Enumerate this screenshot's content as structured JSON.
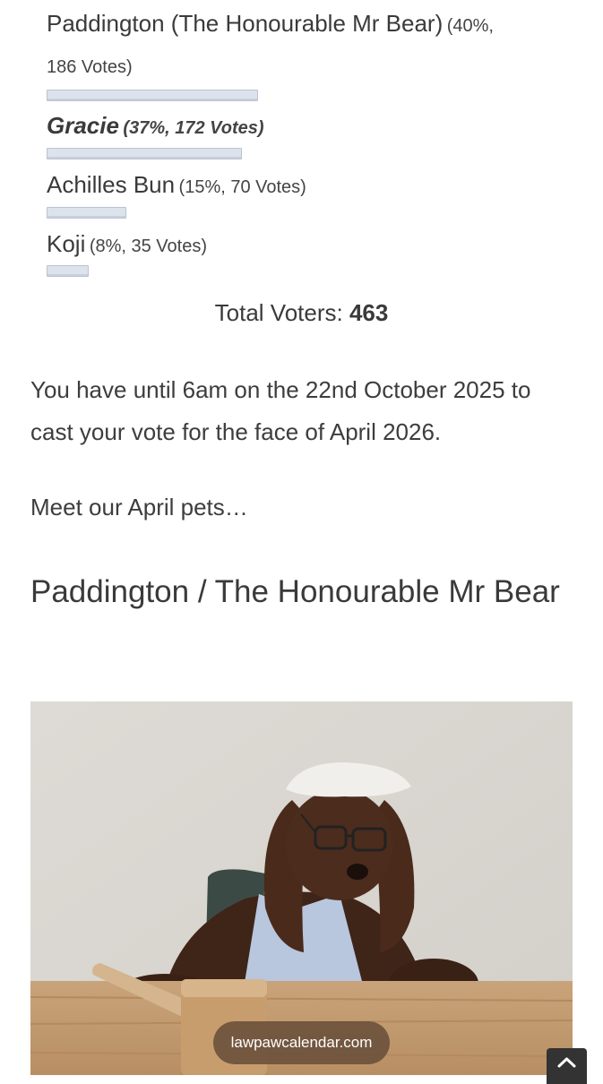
{
  "poll": {
    "options": [
      {
        "name_line1": "Paddington (The Honourable Mr Bear)",
        "meta_line1": "(40%,",
        "meta_line2": "186 Votes)",
        "percent": 40
      },
      {
        "name": "Gracie",
        "meta": "(37%, 172 Votes)",
        "percent": 37
      },
      {
        "name": "Achilles Bun",
        "meta": "(15%, 70 Votes)",
        "percent": 15
      },
      {
        "name": "Koji",
        "meta": "(8%, 35 Votes)",
        "percent": 8
      }
    ],
    "total_label": "Total Voters:",
    "total_value": "463"
  },
  "content": {
    "deadline_text": "You have until 6am on the 22nd October 2025 to cast your vote for the face of April 2026.",
    "meet_text": "Meet our April pets…",
    "pet_heading": "Paddington / The Honourable Mr Bear"
  },
  "watermark": "lawpawcalendar.com",
  "icons": {
    "scroll_top": "chevron-up-icon"
  }
}
